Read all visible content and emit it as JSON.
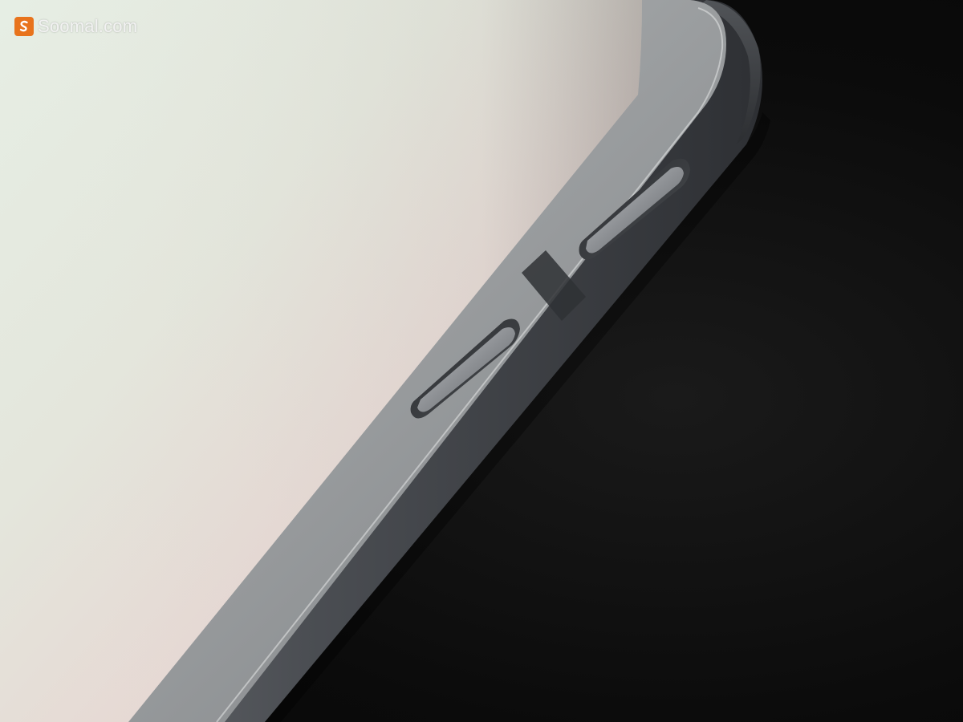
{
  "watermark": {
    "text": "Soomal.com",
    "icon": "soomal-logo-icon",
    "accent_color": "#e8731c"
  },
  "scene": {
    "subject": "tablet-corner-with-side-buttons",
    "background_color": "#0d0d0d",
    "frame_color": "#3a3d42",
    "screen_glow_colors": [
      "#dfe6df",
      "#e8d9d6",
      "#d6c9c6"
    ]
  }
}
